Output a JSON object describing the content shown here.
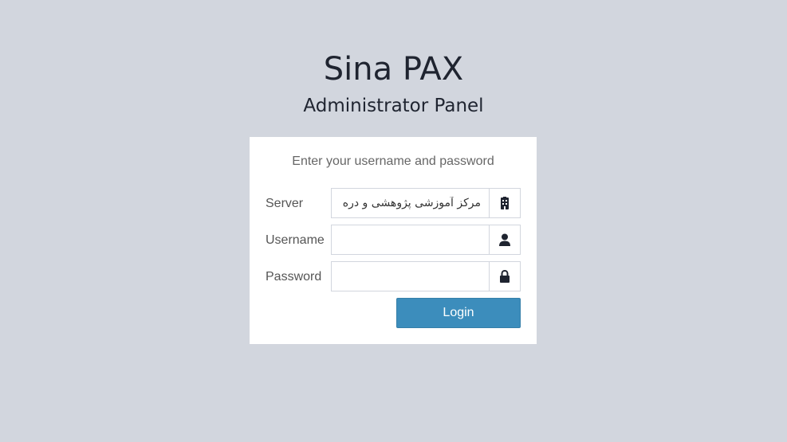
{
  "brand": {
    "title": "Sina PAX",
    "subtitle": "Administrator Panel"
  },
  "login": {
    "message": "Enter your username and password",
    "server": {
      "label": "Server",
      "value": "مرکز آموزشی پژوهشی و دره",
      "icon": "building-icon"
    },
    "username": {
      "label": "Username",
      "value": "",
      "icon": "user-icon"
    },
    "password": {
      "label": "Password",
      "value": "",
      "icon": "lock-icon"
    },
    "button_label": "Login"
  },
  "colors": {
    "background": "#d2d6de",
    "primary": "#3c8dbc",
    "text": "#1f2430"
  }
}
